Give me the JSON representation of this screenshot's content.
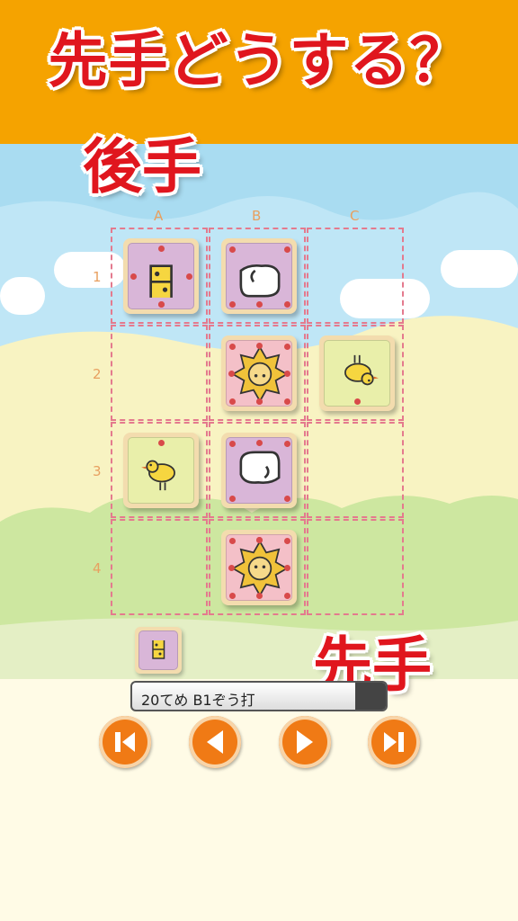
{
  "banner": {
    "title": "先手どうする？"
  },
  "board": {
    "columns": [
      "A",
      "B",
      "C"
    ],
    "rows": [
      "1",
      "2",
      "3",
      "4"
    ],
    "pieces": [
      {
        "cell": "A1",
        "animal": "giraffe",
        "owner": "gote",
        "bg": "#d9b6d8"
      },
      {
        "cell": "B1",
        "animal": "elephant",
        "owner": "gote",
        "bg": "#d9b6d8"
      },
      {
        "cell": "B2",
        "animal": "lion",
        "owner": "gote",
        "bg": "#f4c0c8"
      },
      {
        "cell": "C2",
        "animal": "chick",
        "owner": "gote",
        "bg": "#e9efaa"
      },
      {
        "cell": "A3",
        "animal": "chick",
        "owner": "sente",
        "bg": "#e9efaa"
      },
      {
        "cell": "B3",
        "animal": "elephant",
        "owner": "sente",
        "bg": "#d9b6d8"
      },
      {
        "cell": "B4",
        "animal": "lion",
        "owner": "sente",
        "bg": "#f4c0c8"
      }
    ]
  },
  "players": {
    "gote": "後手",
    "sente": "先手"
  },
  "hands": {
    "sente": [
      {
        "animal": "giraffe"
      }
    ]
  },
  "move_bar": {
    "text": "20てめ B1ぞう打"
  },
  "controls": {
    "first": "first-move-icon",
    "prev": "previous-move-icon",
    "next": "next-move-icon",
    "last": "last-move-icon"
  },
  "colors": {
    "banner": "#f5a300",
    "accent": "#e0161e",
    "control": "#f07a15",
    "grid": "#e47a8e"
  }
}
